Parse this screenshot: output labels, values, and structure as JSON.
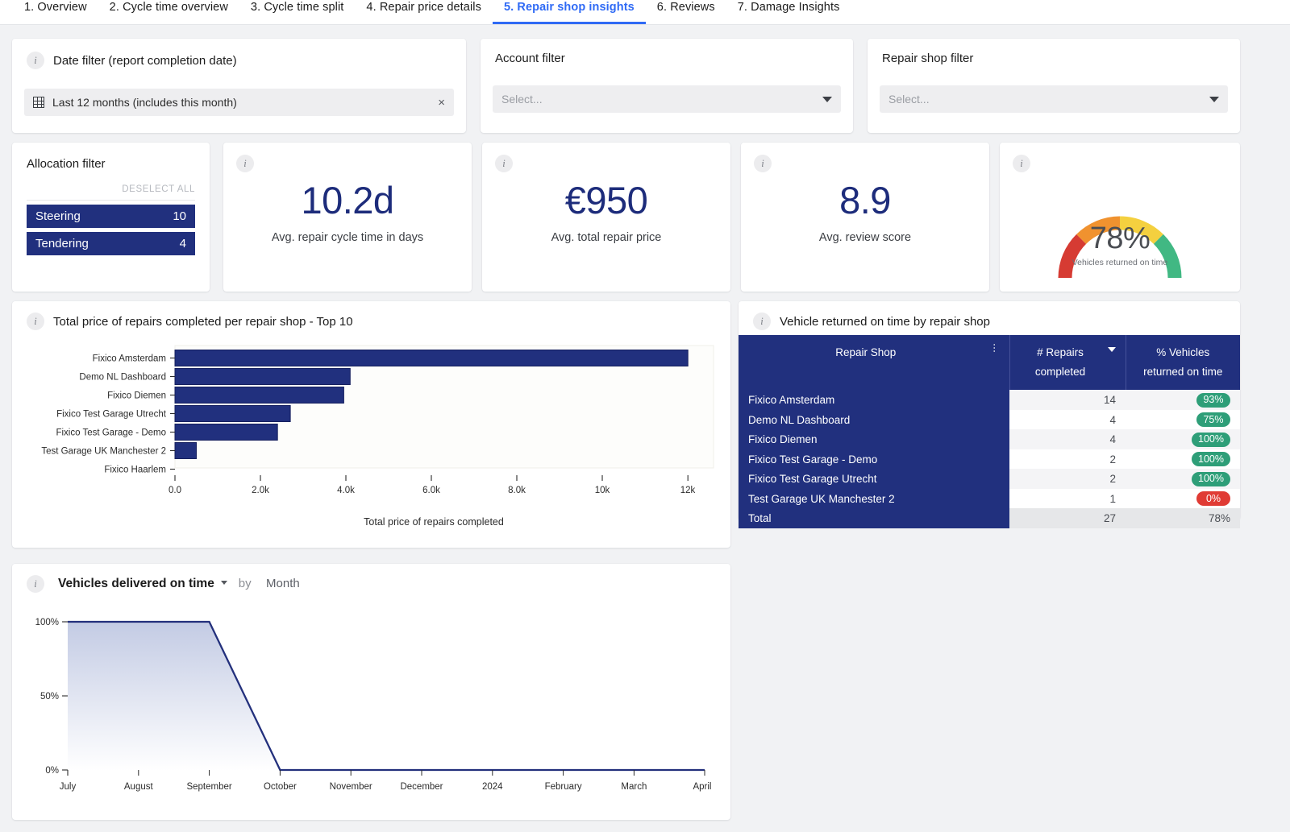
{
  "tabs": [
    {
      "label": "1. Overview",
      "active": false
    },
    {
      "label": "2. Cycle time overview",
      "active": false
    },
    {
      "label": "3. Cycle time split",
      "active": false
    },
    {
      "label": "4. Repair price details",
      "active": false
    },
    {
      "label": "5. Repair shop insights",
      "active": true
    },
    {
      "label": "6. Reviews",
      "active": false
    },
    {
      "label": "7. Damage Insights",
      "active": false
    }
  ],
  "filters": {
    "date": {
      "title": "Date filter (report completion date)",
      "value": "Last 12 months (includes this month)",
      "clear_label": "×",
      "icon": "calendar-icon"
    },
    "account": {
      "title": "Account filter",
      "placeholder": "Select...",
      "value": ""
    },
    "repair_shop": {
      "title": "Repair shop filter",
      "placeholder": "Select...",
      "value": ""
    },
    "allocation": {
      "title": "Allocation filter",
      "deselect_all": "DESELECT ALL",
      "items": [
        {
          "label": "Steering",
          "count": "10",
          "selected": true
        },
        {
          "label": "Tendering",
          "count": "4",
          "selected": true
        }
      ]
    }
  },
  "kpis": [
    {
      "value": "10.2d",
      "caption": "Avg. repair cycle time in days"
    },
    {
      "value": "€950",
      "caption": "Avg. total repair price"
    },
    {
      "value": "8.9",
      "caption": "Avg. review score"
    }
  ],
  "gauge": {
    "value": "78%",
    "caption": "Vehicles returned on time",
    "percent": 78,
    "colors": [
      "#d63b33",
      "#f0922f",
      "#f4d03f",
      "#41b883"
    ]
  },
  "chart_data": [
    {
      "type": "bar",
      "orientation": "horizontal",
      "title": "Total price of repairs completed per repair shop - Top 10",
      "xlabel": "Total price of repairs completed",
      "ylabel": "",
      "categories": [
        "Fixico Amsterdam",
        "Demo NL Dashboard",
        "Fixico Diemen",
        "Fixico Test Garage Utrecht",
        "Fixico Test Garage - Demo",
        "Test Garage UK Manchester 2",
        "Fixico Haarlem"
      ],
      "values": [
        12000,
        4100,
        3950,
        2700,
        2400,
        500,
        0
      ],
      "xlim": [
        0,
        12600
      ],
      "xticks": [
        0,
        2000,
        4000,
        6000,
        8000,
        10000,
        12000
      ],
      "xticklabels": [
        "0.0",
        "2.0k",
        "4.0k",
        "6.0k",
        "8.0k",
        "10k",
        "12k"
      ],
      "bar_color": "#21307e",
      "grid": false,
      "legend": "none"
    },
    {
      "type": "area",
      "title": "Vehicles delivered on time",
      "dropdown_label": "Vehicles delivered on time",
      "by_word": "by",
      "by_value": "Month",
      "x": [
        "July",
        "August",
        "September",
        "October",
        "November",
        "December",
        "2024",
        "February",
        "March",
        "April"
      ],
      "values": [
        100,
        100,
        100,
        0,
        0,
        0,
        0,
        0,
        0,
        0
      ],
      "ylim": [
        0,
        100
      ],
      "yticks": [
        0,
        50,
        100
      ],
      "yticklabels": [
        "0%",
        "50%",
        "100%"
      ],
      "line_color": "#23307c",
      "fill_top": "#c3cbe4",
      "fill_bottom": "#ffffff",
      "grid": false,
      "legend": "none"
    }
  ],
  "bar_panel": {
    "title": "Total price of repairs completed per repair shop - Top 10"
  },
  "table_panel": {
    "title": "Vehicle returned on time by repair shop",
    "columns": [
      {
        "label": "Repair Shop",
        "sub": "",
        "menu": true
      },
      {
        "label": "# Repairs",
        "sub": "completed",
        "sorted": true
      },
      {
        "label": "% Vehicles",
        "sub": "returned on time"
      }
    ],
    "rows": [
      {
        "shop": "Fixico Amsterdam",
        "repairs": "14",
        "pct": "93%",
        "pct_state": "green"
      },
      {
        "shop": "Demo NL Dashboard",
        "repairs": "4",
        "pct": "75%",
        "pct_state": "green"
      },
      {
        "shop": "Fixico Diemen",
        "repairs": "4",
        "pct": "100%",
        "pct_state": "green"
      },
      {
        "shop": "Fixico Test Garage - Demo",
        "repairs": "2",
        "pct": "100%",
        "pct_state": "green"
      },
      {
        "shop": "Fixico Test Garage Utrecht",
        "repairs": "2",
        "pct": "100%",
        "pct_state": "green"
      },
      {
        "shop": "Test Garage UK Manchester 2",
        "repairs": "1",
        "pct": "0%",
        "pct_state": "red"
      }
    ],
    "total": {
      "shop": "Total",
      "repairs": "27",
      "pct": "78%"
    }
  }
}
